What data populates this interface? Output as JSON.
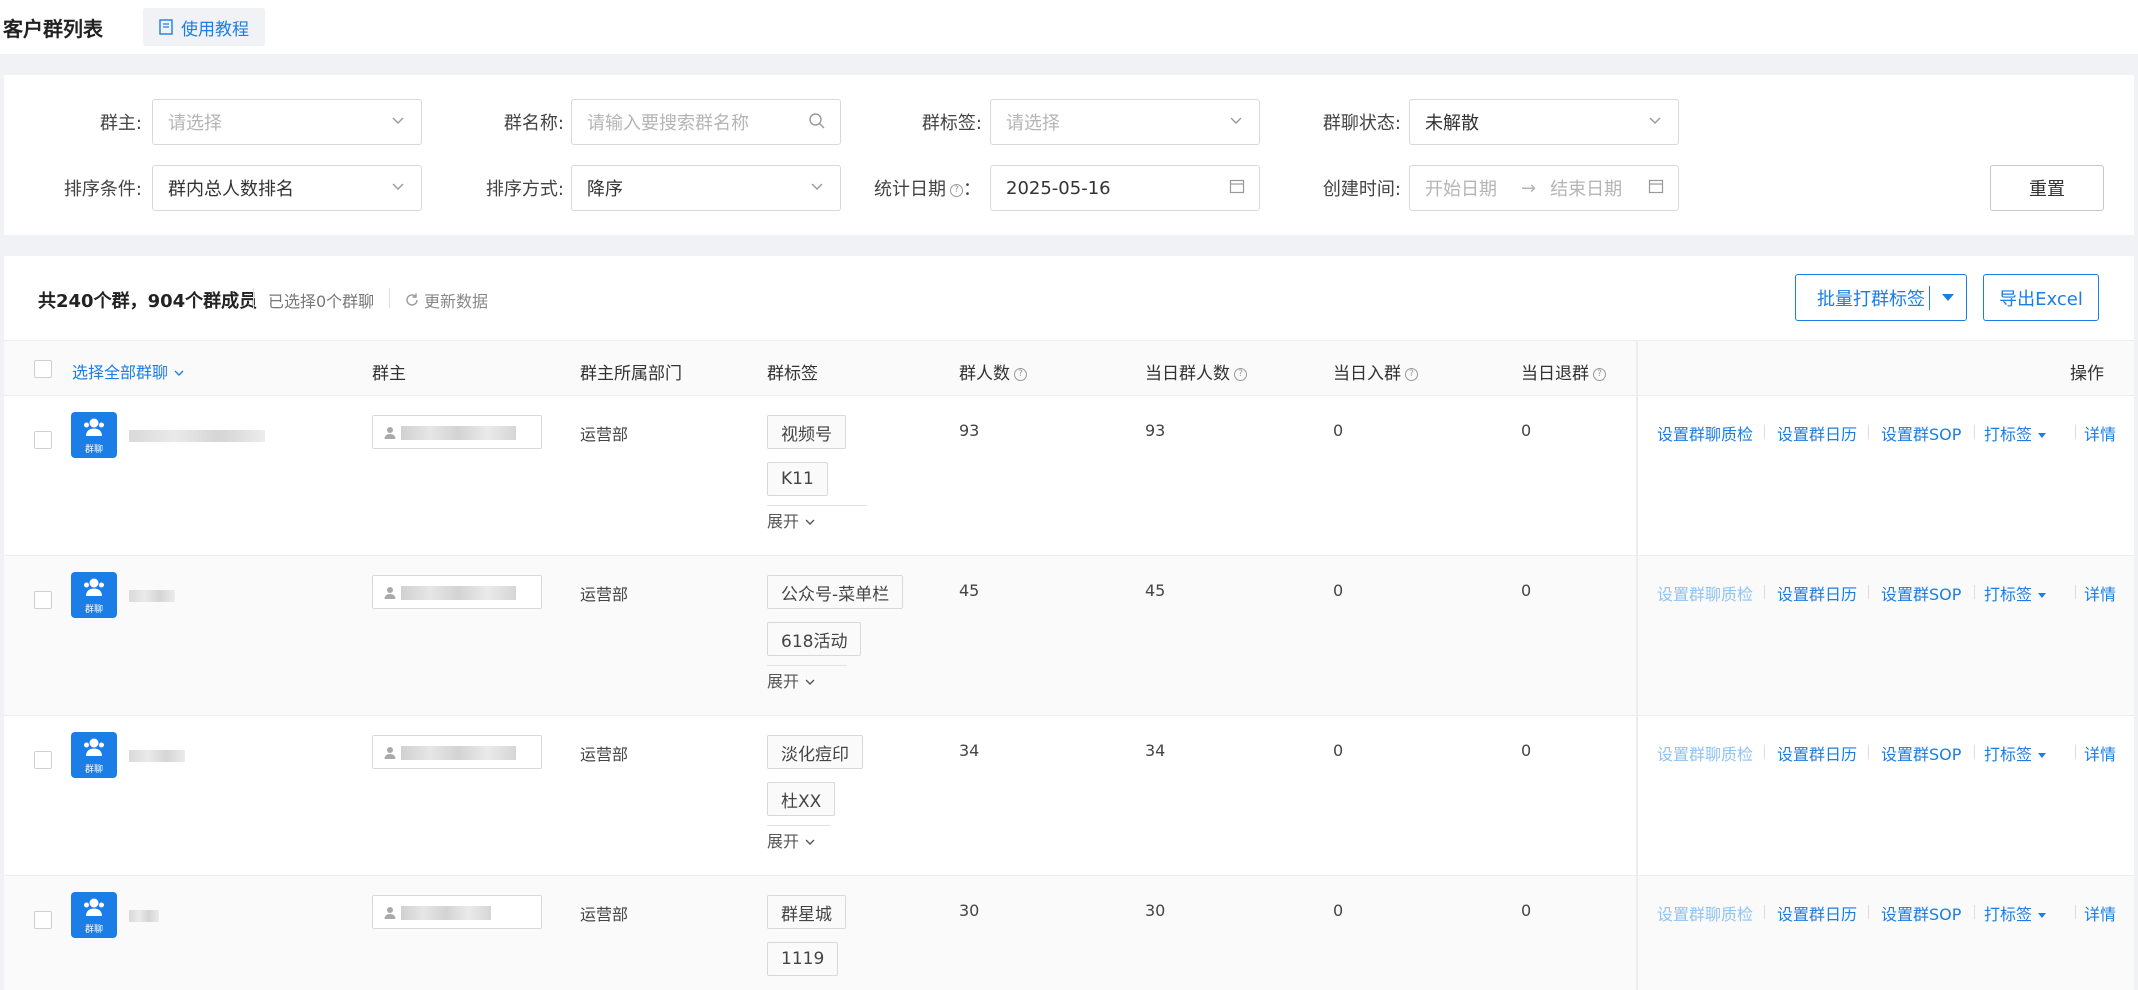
{
  "header": {
    "title": "客户群列表",
    "tutorial_label": "使用教程"
  },
  "filters": {
    "owner": {
      "label": "群主:",
      "placeholder": "请选择"
    },
    "group_name": {
      "label": "群名称:",
      "placeholder": "请输入要搜索群名称"
    },
    "group_tag": {
      "label": "群标签:",
      "placeholder": "请选择"
    },
    "status": {
      "label": "群聊状态:",
      "value": "未解散"
    },
    "sort_condition": {
      "label": "排序条件:",
      "value": "群内总人数排名"
    },
    "sort_order": {
      "label": "排序方式:",
      "value": "降序"
    },
    "stat_date": {
      "label": "统计日期",
      "colon": "：",
      "value": "2025-05-16"
    },
    "create_time": {
      "label": "创建时间:",
      "start_placeholder": "开始日期",
      "end_placeholder": "结束日期",
      "arrow": "→"
    },
    "reset_label": "重置"
  },
  "toolbar": {
    "summary": "共240个群，904个群成员",
    "selected": "已选择0个群聊",
    "refresh": "更新数据",
    "batch_tag": "批量打群标签",
    "export": "导出Excel"
  },
  "table": {
    "select_all": "选择全部群聊",
    "columns": {
      "owner": "群主",
      "dept": "群主所属部门",
      "tags": "群标签",
      "members": "群人数",
      "today_members": "当日群人数",
      "today_join": "当日入群",
      "today_quit": "当日退群",
      "actions": "操作"
    },
    "avatar_label": "群聊",
    "expand_label": "展开",
    "actions": {
      "quality": "设置群聊质检",
      "calendar": "设置群日历",
      "sop": "设置群SOP",
      "tag": "打标签",
      "detail": "详情"
    },
    "rows": [
      {
        "dept": "运营部",
        "tags": [
          "视频号",
          "K11"
        ],
        "members": "93",
        "today_members": "93",
        "today_join": "0",
        "today_quit": "0"
      },
      {
        "dept": "运营部",
        "tags": [
          "公众号-菜单栏",
          "618活动"
        ],
        "members": "45",
        "today_members": "45",
        "today_join": "0",
        "today_quit": "0"
      },
      {
        "dept": "运营部",
        "tags": [
          "淡化痘印",
          "杜XX"
        ],
        "members": "34",
        "today_members": "34",
        "today_join": "0",
        "today_quit": "0"
      },
      {
        "dept": "运营部",
        "tags": [
          "群星城",
          "1119"
        ],
        "members": "30",
        "today_members": "30",
        "today_join": "0",
        "today_quit": "0"
      }
    ]
  },
  "colors": {
    "accent": "#1a7ee6",
    "accent_disabled": "#8fc3f4"
  }
}
